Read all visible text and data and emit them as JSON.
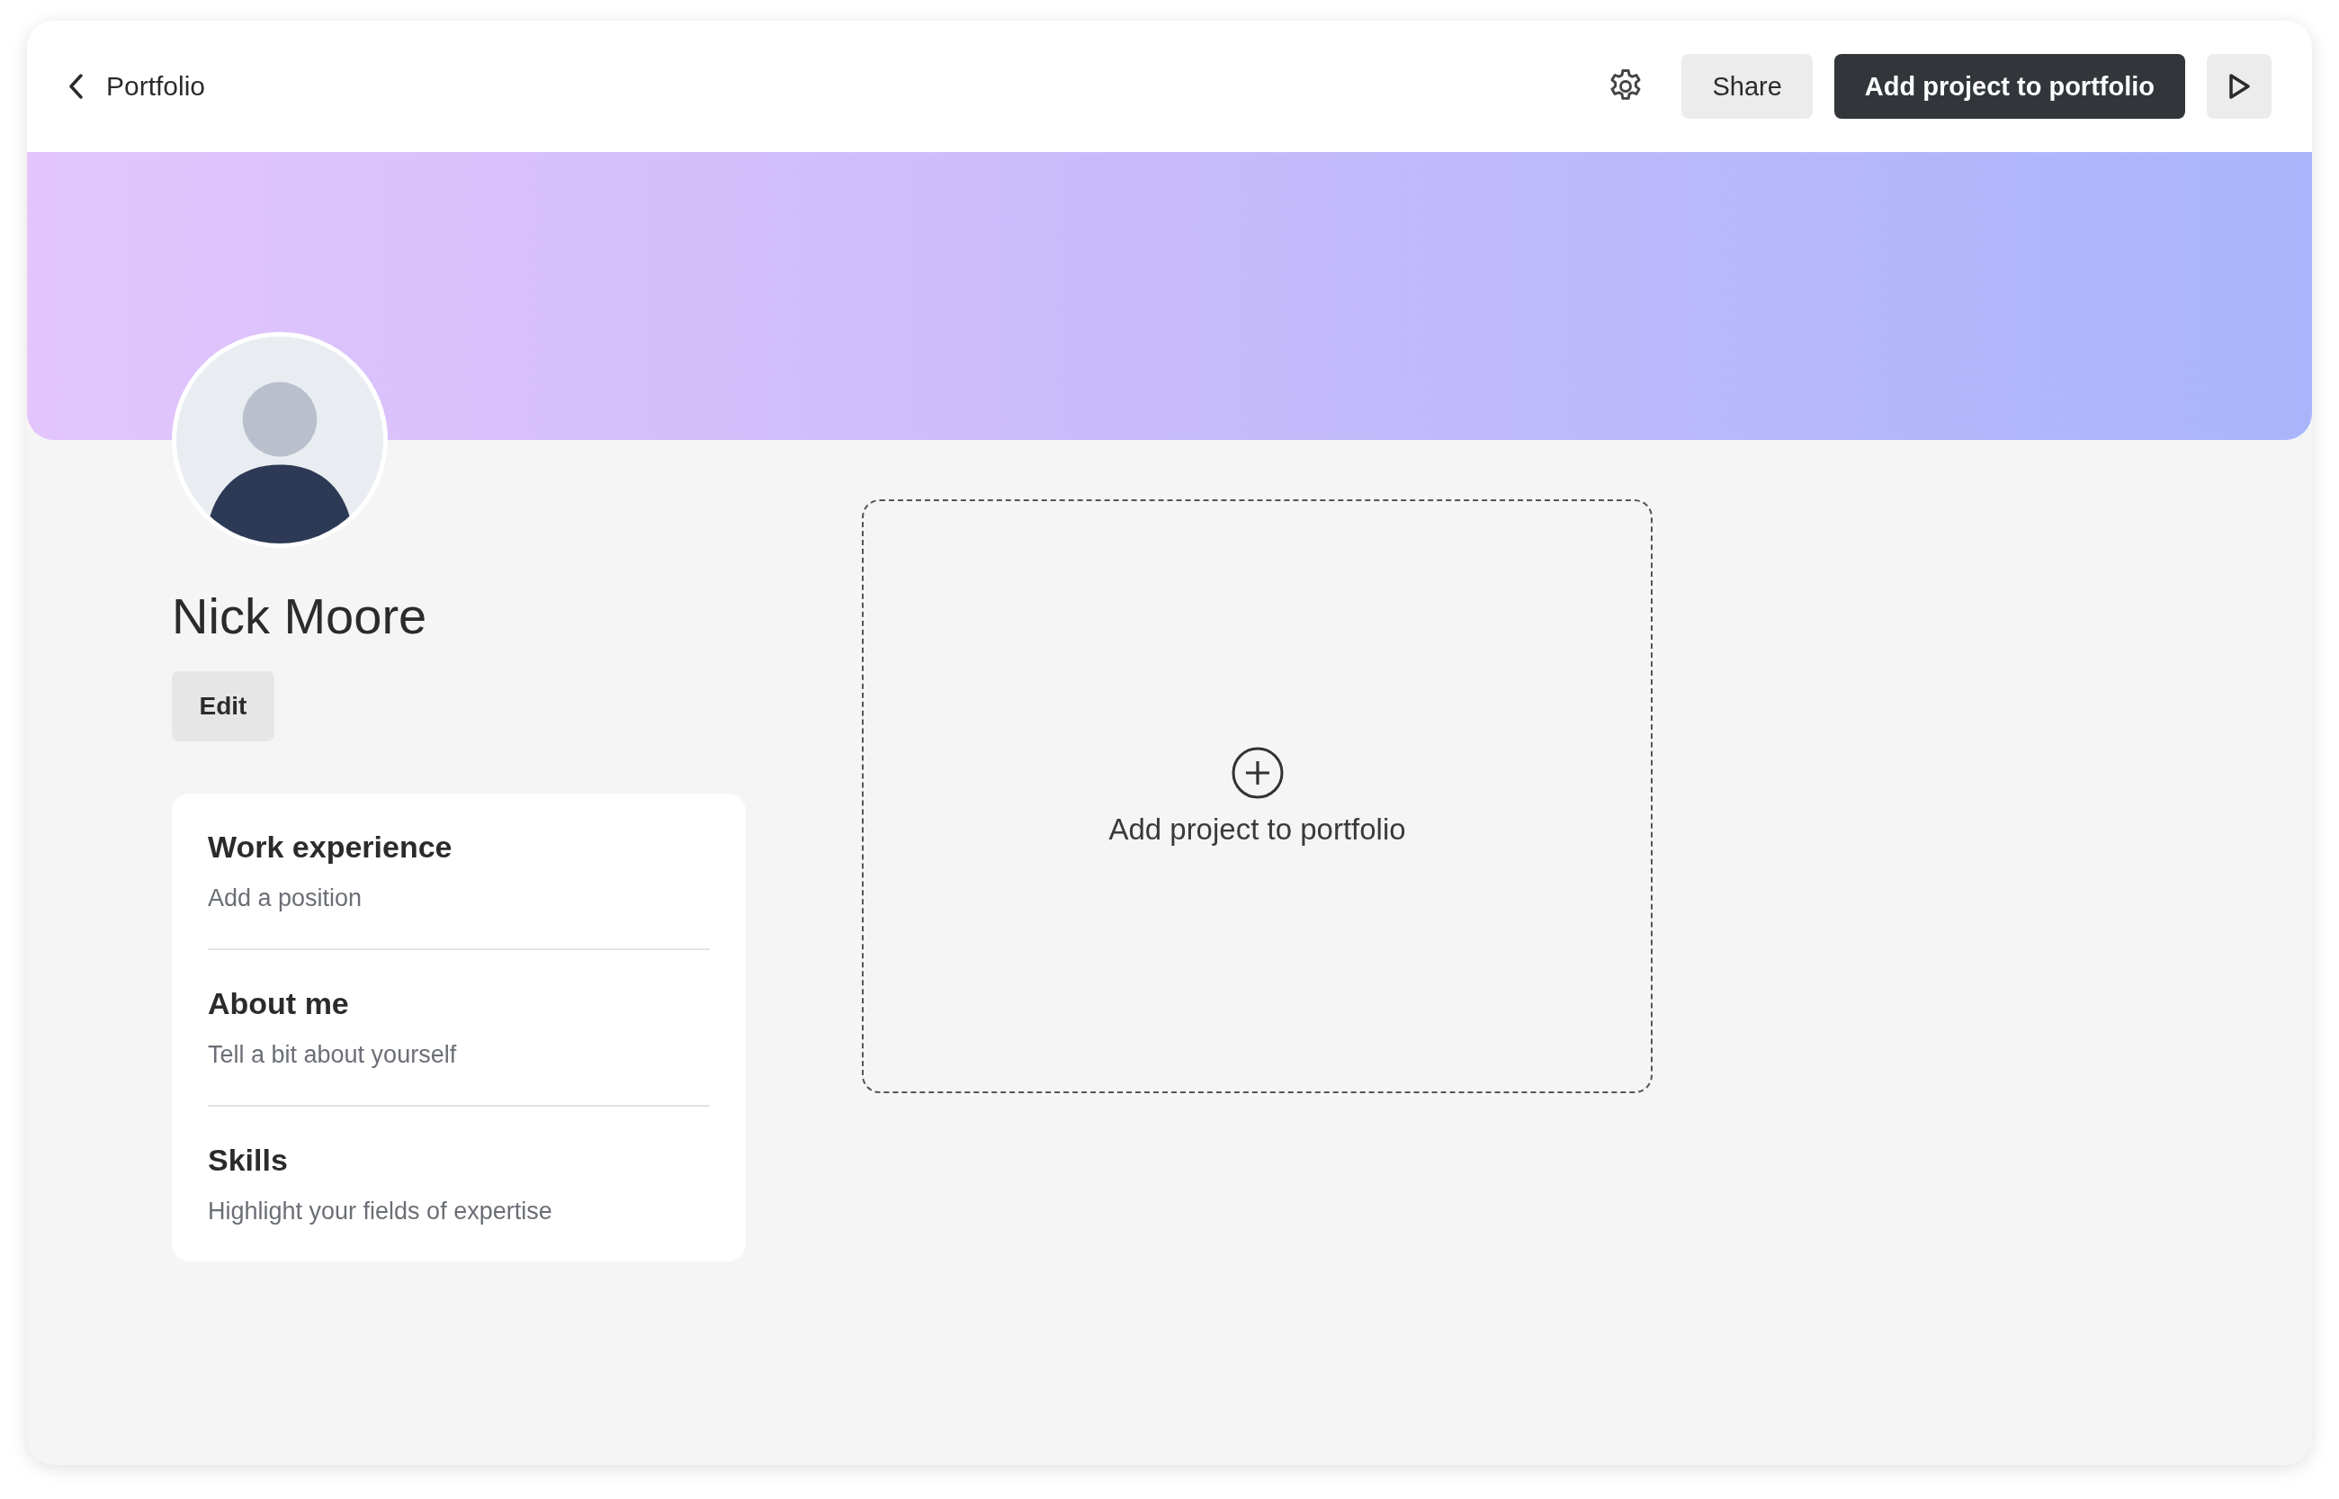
{
  "top_bar": {
    "back_label": "Portfolio",
    "share_label": "Share",
    "add_label": "Add project to portfolio"
  },
  "profile": {
    "name": "Nick Moore",
    "edit_label": "Edit"
  },
  "sections": [
    {
      "title": "Work experience",
      "subtitle": "Add a position"
    },
    {
      "title": "About me",
      "subtitle": "Tell a bit about yourself"
    },
    {
      "title": "Skills",
      "subtitle": "Highlight your fields of expertise"
    }
  ],
  "add_project": {
    "label": "Add project to portfolio"
  }
}
